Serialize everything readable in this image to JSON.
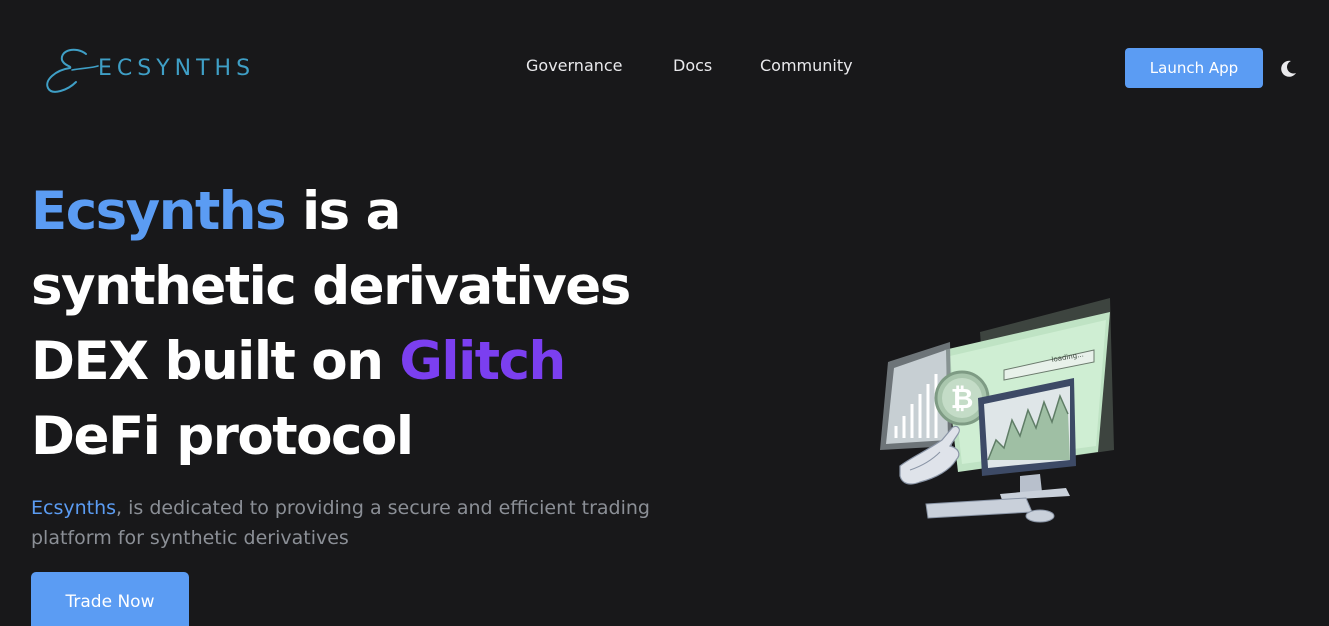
{
  "header": {
    "brand_name": "ECSYNTHS",
    "logo_color": "#3f9fc6",
    "nav": [
      {
        "label": "Governance"
      },
      {
        "label": "Docs"
      },
      {
        "label": "Community"
      }
    ],
    "launch_label": "Launch App",
    "theme_icon": "moon-icon"
  },
  "hero": {
    "title_brand": "Ecsynths",
    "title_part1": " is a",
    "title_line2": "synthetic derivatives",
    "title_line3_prefix": "DEX built on ",
    "title_line3_accent": "Glitch",
    "title_line4": "DeFi protocol",
    "desc_brand": "Ecsynths",
    "desc_text": ", is dedicated to providing a secure and efficient trading platform for synthetic derivatives",
    "cta_label": "Trade Now",
    "illustration_loading_text": "loading..."
  },
  "colors": {
    "background": "#18181a",
    "accent_blue": "#5b9cf3",
    "accent_purple": "#7b3ff0",
    "muted_text": "#8b8f96"
  }
}
